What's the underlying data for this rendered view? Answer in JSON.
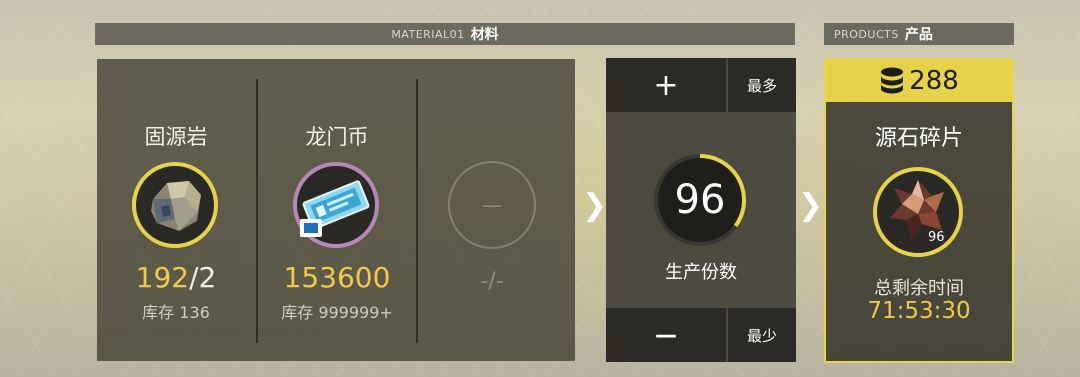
{
  "header": {
    "materials_en": "MATERIAL01",
    "materials_cn": "材料",
    "products_en": "PRODUCTS",
    "products_cn": "产品"
  },
  "materials": [
    {
      "name": "固源岩",
      "amount_have": "192",
      "amount_sep": "/",
      "amount_need": "2",
      "stock_label": "库存",
      "stock_value": "136",
      "icon": "rock-icon"
    },
    {
      "name": "龙门币",
      "amount_have": "153600",
      "stock_label": "库存",
      "stock_value": "999999+",
      "icon": "lmd-ticket-icon"
    },
    {
      "empty_symbol": "—",
      "empty_amount": "-/-"
    }
  ],
  "quantity": {
    "plus_label": "+",
    "max_label": "最多",
    "value": "96",
    "label": "生产份数",
    "minus_label": "—",
    "min_label": "最少",
    "ring_fill_fraction": 0.35
  },
  "product": {
    "count": "288",
    "name": "源石碎片",
    "badge": "96",
    "time_label": "总剩余时间",
    "time_value": "71:53:30",
    "icon": "originium-shard-icon"
  },
  "colors": {
    "accent_yellow": "#f2c94c",
    "highlight_yellow": "#e7d34b",
    "panel_dark": "#2b2a26"
  }
}
